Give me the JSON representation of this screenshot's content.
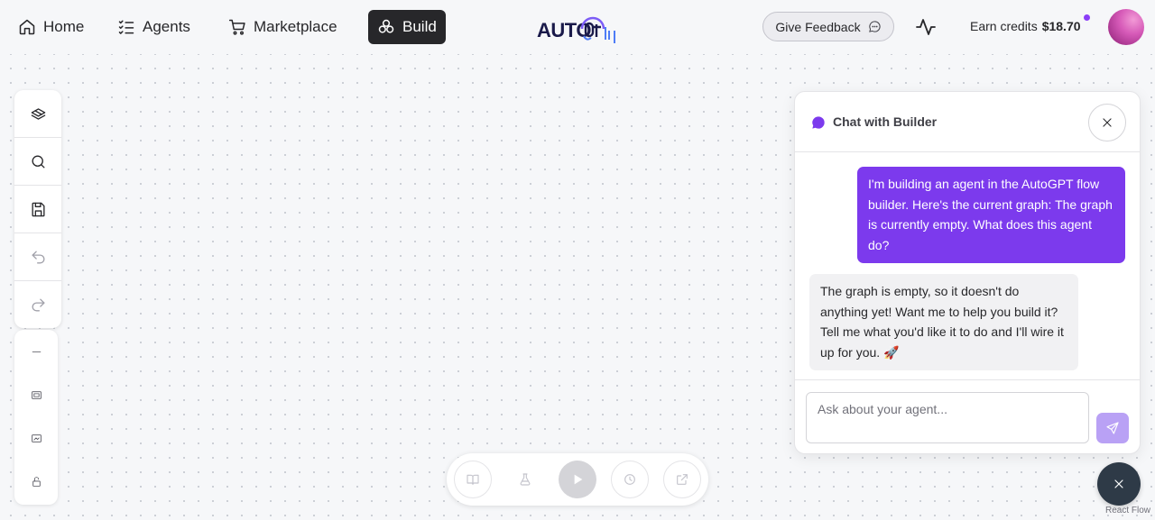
{
  "nav": {
    "home": "Home",
    "agents": "Agents",
    "marketplace": "Marketplace",
    "build": "Build",
    "logo_text": "AUTO",
    "feedback": "Give Feedback",
    "credits_label": "Earn credits",
    "credits_value": "$18.70"
  },
  "toolbar": {
    "items": [
      "blocks-icon",
      "search-icon",
      "save-icon",
      "undo-icon",
      "redo-icon"
    ],
    "zoom": [
      "zoom-out-icon",
      "fit-view-icon",
      "toggle-minimap-icon",
      "lock-icon"
    ]
  },
  "runbar": {
    "buttons": [
      "library-icon",
      "flask-icon",
      "play-icon",
      "history-icon",
      "share-icon"
    ]
  },
  "chat": {
    "title": "Chat with Builder",
    "user_message": "I'm building an agent in the AutoGPT flow builder. Here's the current graph: The graph is currently empty. What does this agent do?",
    "bot_message": "The graph is empty, so it doesn't do anything yet! Want me to help you build it? Tell me what you'd like it to do and I'll wire it up for you. 🚀",
    "input_placeholder": "Ask about your agent..."
  },
  "attribution": "React Flow",
  "colors": {
    "accent": "#7c3aed",
    "build_active_bg": "#27272a",
    "fab_bg": "#2e3a47"
  }
}
